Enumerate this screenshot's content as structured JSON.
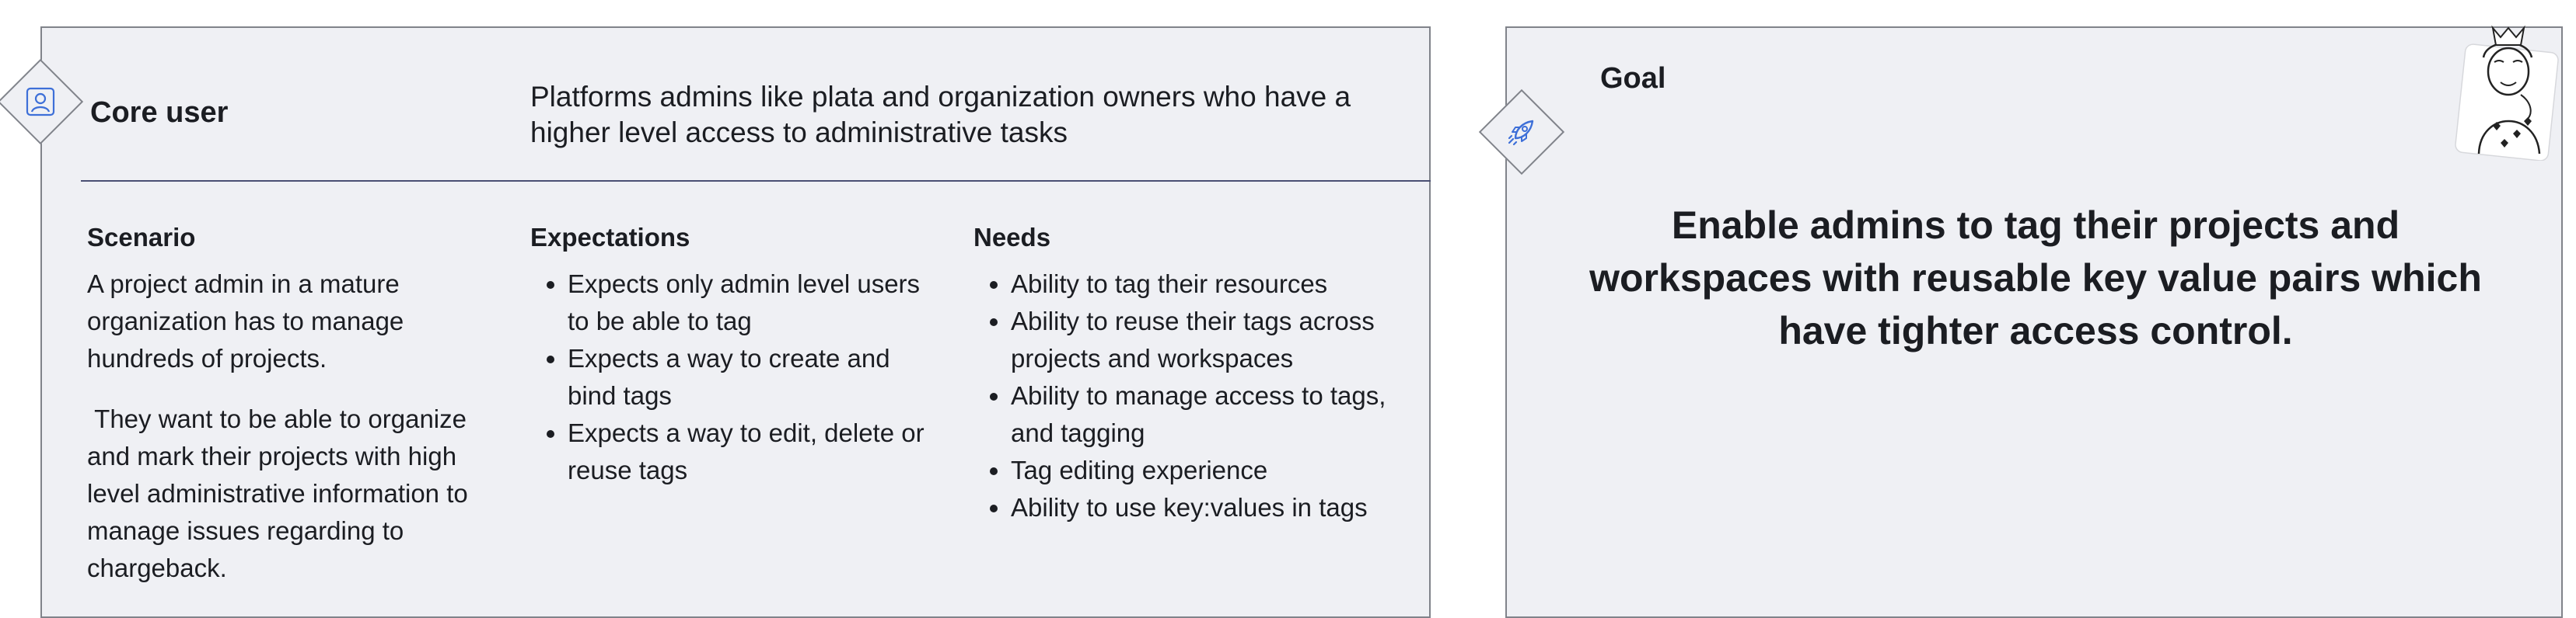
{
  "core_user": {
    "title": "Core user",
    "description": "Platforms admins like plata and organization owners who have a higher level access to administrative tasks",
    "icon": "user-icon"
  },
  "scenario": {
    "heading": "Scenario",
    "paragraphs": [
      "A project admin in a mature organization has to manage hundreds of projects.",
      " They want to be able to organize and mark their projects with high level administrative information to manage issues regarding to chargeback."
    ]
  },
  "expectations": {
    "heading": "Expectations",
    "items": [
      "Expects only admin level users to be able to tag",
      "Expects a way to create and bind tags",
      "Expects a way to edit, delete or reuse tags"
    ]
  },
  "needs": {
    "heading": "Needs",
    "items": [
      "Ability to tag their resources",
      "Ability to reuse their tags across projects and workspaces",
      "Ability to manage access to tags, and tagging",
      "Tag editing experience",
      "Ability to use key:values in tags"
    ]
  },
  "goal": {
    "title": "Goal",
    "text": "Enable admins to tag their projects and workspaces with reusable key value pairs which have tighter access control.",
    "icon": "rocket-icon"
  },
  "colors": {
    "accent": "#3d6fd8",
    "card_bg": "#eff0f4",
    "border": "#80838a",
    "divider": "#4a4f73"
  }
}
